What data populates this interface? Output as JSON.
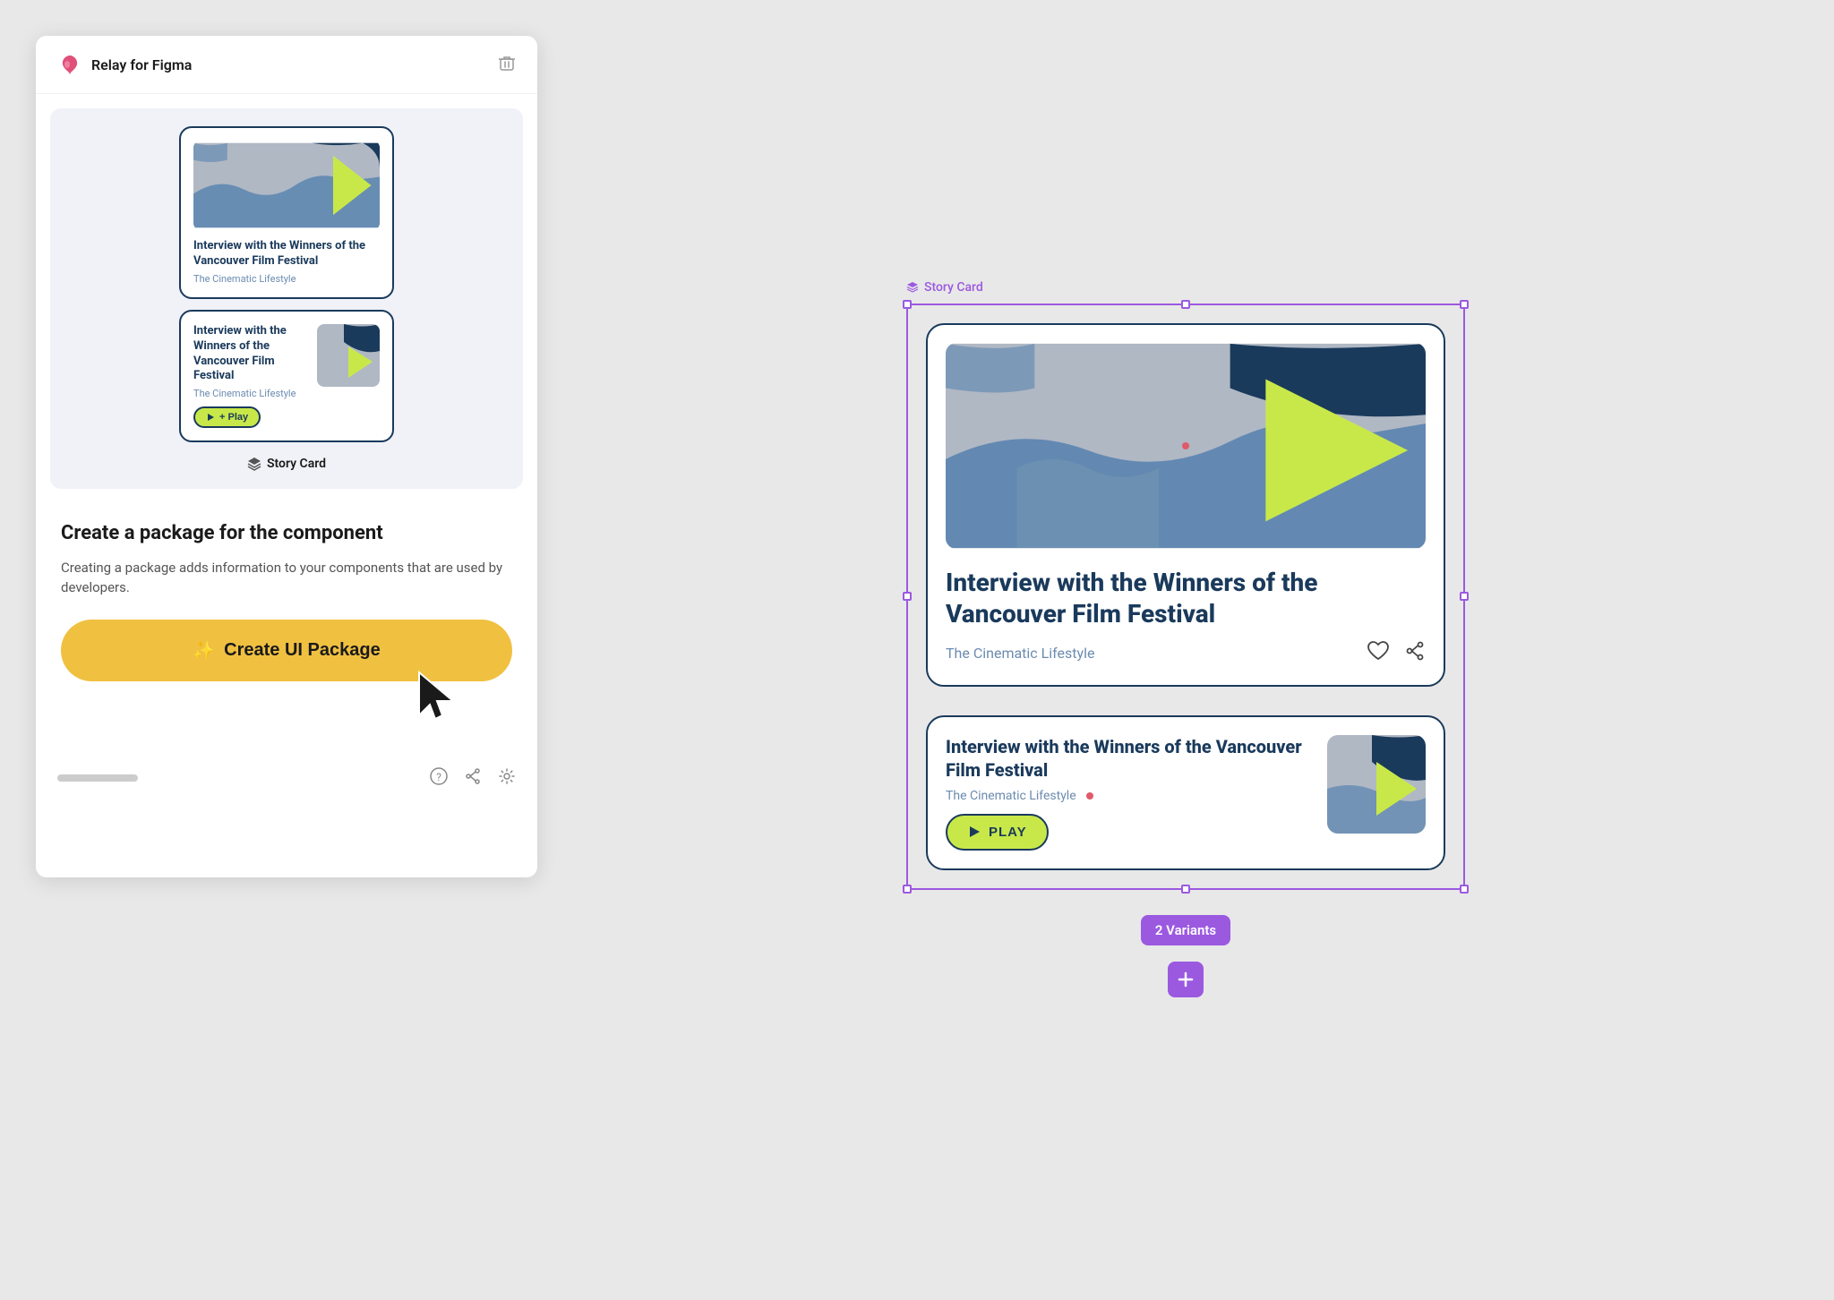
{
  "app": {
    "title": "Relay for Figma",
    "trash_icon": "🗑"
  },
  "preview_label": "Story Card",
  "card1": {
    "title": "Interview with the Winners of the Vancouver Film Festival",
    "subtitle": "The Cinematic Lifestyle"
  },
  "card2": {
    "title": "Interview with the Winners of the Vancouver Film Festival",
    "subtitle": "The Cinematic Lifestyle",
    "play_label": "+ Play"
  },
  "component": {
    "heading": "Create a package for the component",
    "description": "Creating a package adds information to your components that are used by developers.",
    "button_label": "Create UI Package",
    "button_icon": "✨"
  },
  "right_card1": {
    "title": "Interview with the Winners of the Vancouver Film Festival",
    "channel": "The Cinematic Lifestyle"
  },
  "right_card2": {
    "title": "Interview with the Winners of the Vancouver Film Festival",
    "channel": "The Cinematic Lifestyle",
    "play_label": "PLAY"
  },
  "frame_label": "Story Card",
  "variants_badge": "2 Variants",
  "footer": {
    "help_icon": "?",
    "share_icon": "share",
    "settings_icon": "⚙"
  }
}
